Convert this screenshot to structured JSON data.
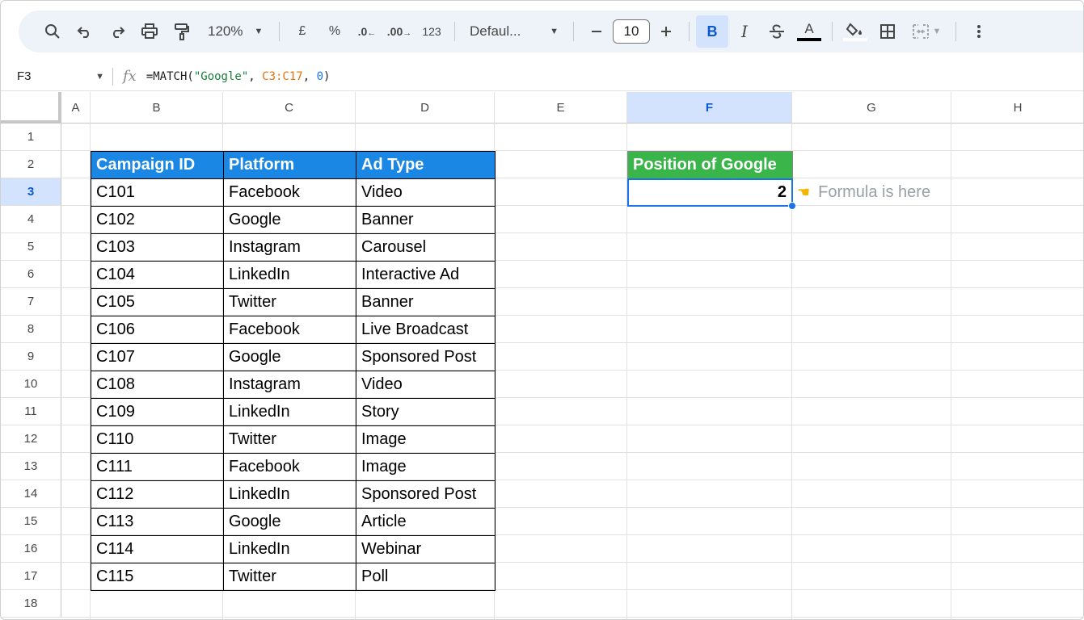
{
  "toolbar": {
    "zoom": "120%",
    "currency_symbol": "£",
    "percent_symbol": "%",
    "decrease_decimal": ".0",
    "increase_decimal": ".00",
    "number_format": "123",
    "font_name": "Defaul...",
    "font_size": "10",
    "bold_label": "B",
    "italic_label": "I",
    "text_color_label": "A"
  },
  "formula_bar": {
    "name_box": "F3",
    "fx": "fx",
    "formula_prefix": "=MATCH(",
    "formula_string": "\"Google\"",
    "formula_comma1": ", ",
    "formula_range": "C3:C17",
    "formula_comma2": ", ",
    "formula_number": "0",
    "formula_suffix": ")"
  },
  "columns": [
    "A",
    "B",
    "C",
    "D",
    "E",
    "F",
    "G",
    "H"
  ],
  "selected_column": "F",
  "rows": [
    "1",
    "2",
    "3",
    "4",
    "5",
    "6",
    "7",
    "8",
    "9",
    "10",
    "11",
    "12",
    "13",
    "14",
    "15",
    "16",
    "17",
    "18"
  ],
  "selected_row": "3",
  "table": {
    "headers": [
      "Campaign ID",
      "Platform",
      "Ad Type"
    ],
    "rows": [
      [
        "C101",
        "Facebook",
        "Video"
      ],
      [
        "C102",
        "Google",
        "Banner"
      ],
      [
        "C103",
        "Instagram",
        "Carousel"
      ],
      [
        "C104",
        "LinkedIn",
        "Interactive Ad"
      ],
      [
        "C105",
        "Twitter",
        "Banner"
      ],
      [
        "C106",
        "Facebook",
        "Live Broadcast"
      ],
      [
        "C107",
        "Google",
        "Sponsored Post"
      ],
      [
        "C108",
        "Instagram",
        "Video"
      ],
      [
        "C109",
        "LinkedIn",
        "Story"
      ],
      [
        "C110",
        "Twitter",
        "Image"
      ],
      [
        "C111",
        "Facebook",
        "Image"
      ],
      [
        "C112",
        "LinkedIn",
        "Sponsored Post"
      ],
      [
        "C113",
        "Google",
        "Article"
      ],
      [
        "C114",
        "LinkedIn",
        "Webinar"
      ],
      [
        "C115",
        "Twitter",
        "Poll"
      ]
    ]
  },
  "result": {
    "header": "Position of Google",
    "value": "2",
    "note": "Formula is here",
    "note_icon": "pointing-hand-icon"
  },
  "colors": {
    "table_header": "#1a87e5",
    "result_header": "#3ab54a",
    "selection": "#1a73e8"
  }
}
